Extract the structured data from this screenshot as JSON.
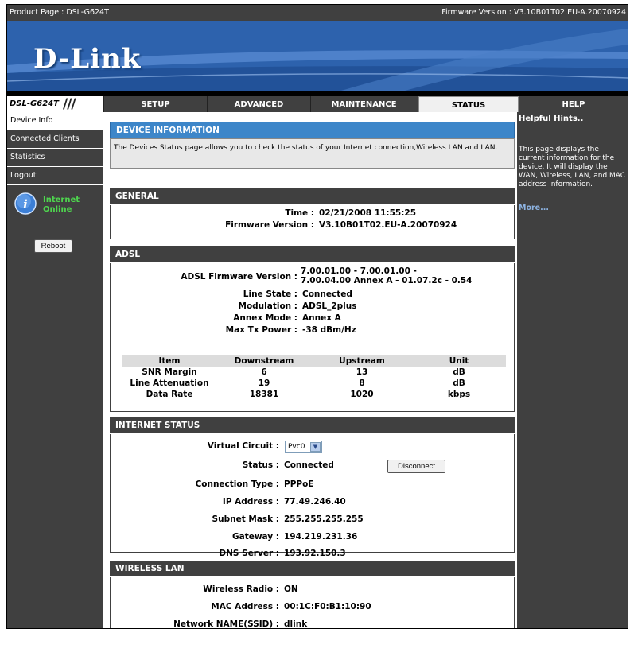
{
  "topbar": {
    "product": "Product Page : DSL-G624T",
    "firmware": "Firmware Version : V3.10B01T02.EU-A.20070924"
  },
  "logo": "D-Link",
  "nav": {
    "model": "DSL-G624T",
    "tabs": [
      "SETUP",
      "ADVANCED",
      "MAINTENANCE",
      "STATUS",
      "HELP"
    ],
    "active": "STATUS"
  },
  "sidebar": {
    "items": [
      "Device Info",
      "Connected Clients",
      "Statistics",
      "Logout"
    ],
    "internet_line1": "Internet",
    "internet_line2": "Online",
    "reboot": "Reboot"
  },
  "device_info": {
    "title": "DEVICE INFORMATION",
    "description": "The Devices Status page allows you to check the status of your Internet connection,Wireless LAN and LAN."
  },
  "general": {
    "title": "GENERAL",
    "time_label": "Time :",
    "time": "02/21/2008 11:55:25",
    "fw_label": "Firmware Version :",
    "fw": "V3.10B01T02.EU-A.20070924"
  },
  "adsl": {
    "title": "ADSL",
    "fw_label": "ADSL Firmware Version :",
    "fw_line1": "7.00.01.00 - 7.00.01.00 -",
    "fw_line2": "7.00.04.00 Annex A - 01.07.2c - 0.54",
    "line_state_label": "Line State :",
    "line_state": "Connected",
    "modulation_label": "Modulation :",
    "modulation": "ADSL_2plus",
    "annex_label": "Annex Mode :",
    "annex": "Annex A",
    "maxtx_label": "Max Tx Power :",
    "maxtx": "-38 dBm/Hz",
    "table": {
      "headers": [
        "Item",
        "Downstream",
        "Upstream",
        "Unit"
      ],
      "rows": [
        [
          "SNR Margin",
          "6",
          "13",
          "dB"
        ],
        [
          "Line Attenuation",
          "19",
          "8",
          "dB"
        ],
        [
          "Data Rate",
          "18381",
          "1020",
          "kbps"
        ]
      ]
    }
  },
  "internet": {
    "title": "INTERNET STATUS",
    "vc_label": "Virtual Circuit :",
    "vc": "Pvc0",
    "status_label": "Status :",
    "status": "Connected",
    "disconnect": "Disconnect",
    "ctype_label": "Connection Type :",
    "ctype": "PPPoE",
    "ip_label": "IP Address :",
    "ip": "77.49.246.40",
    "mask_label": "Subnet Mask :",
    "mask": "255.255.255.255",
    "gw_label": "Gateway :",
    "gw": "194.219.231.36",
    "dns_label": "DNS Server :",
    "dns": "193.92.150.3"
  },
  "wireless": {
    "title": "WIRELESS LAN",
    "radio_label": "Wireless Radio :",
    "radio": "ON",
    "mac_label": "MAC Address :",
    "mac": "00:1C:F0:B1:10:90",
    "ssid_label": "Network NAME(SSID) :",
    "ssid": "dlink"
  },
  "help": {
    "title": "Helpful Hints..",
    "text": "This page displays the current information for the device. It will display the WAN, Wireless, LAN, and MAC address information.",
    "more": "More..."
  }
}
